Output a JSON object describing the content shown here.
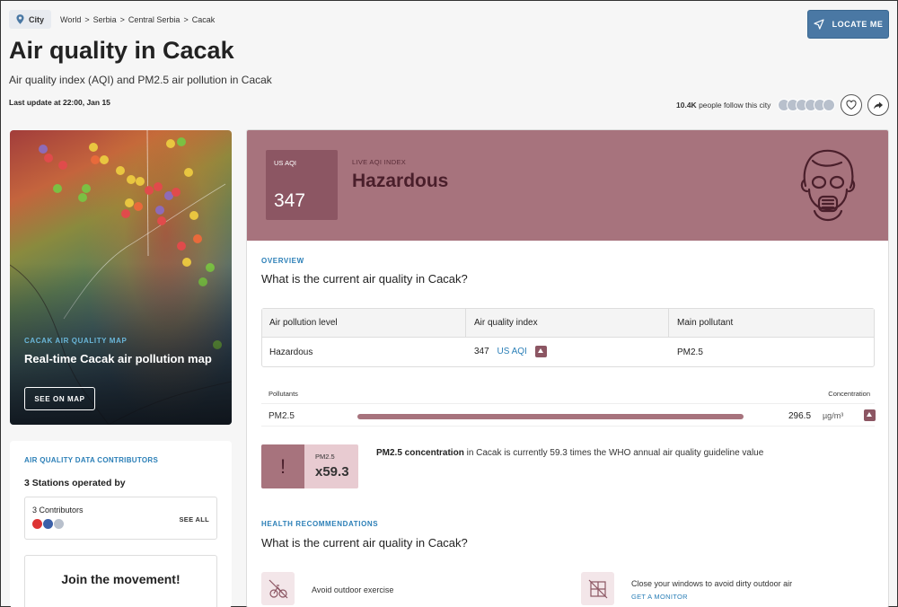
{
  "header": {
    "city_chip": "City",
    "breadcrumb": [
      "World",
      ">",
      "Serbia",
      ">",
      "Central Serbia",
      ">",
      "Cacak"
    ],
    "locate_label": "LOCATE ME",
    "title": "Air quality in Cacak",
    "subtitle": "Air quality index (AQI) and PM2.5 air pollution in Cacak",
    "last_update": "Last update at 22:00, Jan 15",
    "followers_count": "10.4K",
    "followers_text": "people follow this city"
  },
  "map_card": {
    "eyebrow": "CACAK AIR QUALITY MAP",
    "title": "Real-time Cacak air pollution map",
    "button": "SEE ON MAP"
  },
  "contributors": {
    "eyebrow": "AIR QUALITY DATA CONTRIBUTORS",
    "stations": "3 Stations operated by",
    "count": "3 Contributors",
    "see_all": "SEE ALL",
    "join": "Join the movement!"
  },
  "aqi": {
    "box_label": "US AQI",
    "value": "347",
    "live_label": "LIVE AQI INDEX",
    "level": "Hazardous",
    "color": "#a7737d"
  },
  "overview": {
    "eyebrow": "OVERVIEW",
    "question": "What is the current air quality in Cacak?",
    "table_headers": [
      "Air pollution level",
      "Air quality index",
      "Main pollutant"
    ],
    "level": "Hazardous",
    "aqi_value": "347",
    "aqi_unit": "US AQI",
    "main_pollutant": "PM2.5"
  },
  "pollutants": {
    "left_header": "Pollutants",
    "right_header": "Concentration",
    "name": "PM2.5",
    "value": "296.5",
    "unit": "µg/m³"
  },
  "ratio": {
    "bang": "!",
    "label": "PM2.5",
    "value": "x59.3",
    "text_bold": "PM2.5 concentration",
    "text_rest": " in Cacak is currently 59.3 times the WHO annual air quality guideline value"
  },
  "health": {
    "eyebrow": "HEALTH RECOMMENDATIONS",
    "question": "What is the current air quality in Cacak?",
    "rec1": "Avoid outdoor exercise",
    "rec2": "Close your windows to avoid dirty outdoor air",
    "rec2_link": "GET A MONITOR"
  }
}
